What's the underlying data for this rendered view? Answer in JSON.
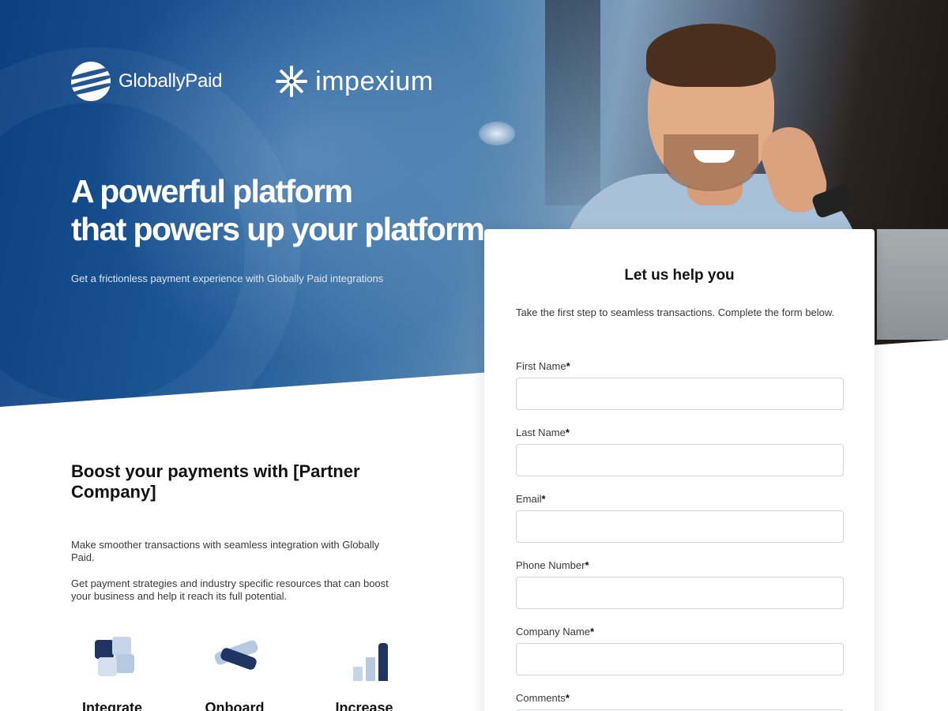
{
  "brand": {
    "globallypaid": "GloballyPaid",
    "impexium": "impexium"
  },
  "hero": {
    "title_line1": "A powerful platform",
    "title_line2": "that powers up your platform",
    "subtitle": "Get a frictionless payment experience with Globally Paid integrations"
  },
  "content": {
    "heading": "Boost your payments with [Partner Company]",
    "paragraph1": "Make smoother transactions with seamless integration with Globally Paid.",
    "paragraph2": "Get payment strategies and industry specific resources that can boost your business and help it reach its full potential."
  },
  "features": [
    {
      "label": "Integrate",
      "icon": "puzzle-icon"
    },
    {
      "label": "Onboard",
      "icon": "handshake-icon"
    },
    {
      "label": "Increase",
      "icon": "growth-chart-icon"
    }
  ],
  "form": {
    "title": "Let us help you",
    "description": "Take the first step to seamless transactions. Complete the form below.",
    "required_marker": "*",
    "fields": [
      {
        "label": "First Name",
        "value": ""
      },
      {
        "label": "Last Name",
        "value": ""
      },
      {
        "label": "Email",
        "value": ""
      },
      {
        "label": "Phone Number",
        "value": ""
      },
      {
        "label": "Company Name",
        "value": ""
      },
      {
        "label": "Comments",
        "value": ""
      }
    ]
  },
  "colors": {
    "brand_blue": "#0c3f80",
    "icon_navy": "#1f3461",
    "icon_light": "#b7c9e0"
  }
}
